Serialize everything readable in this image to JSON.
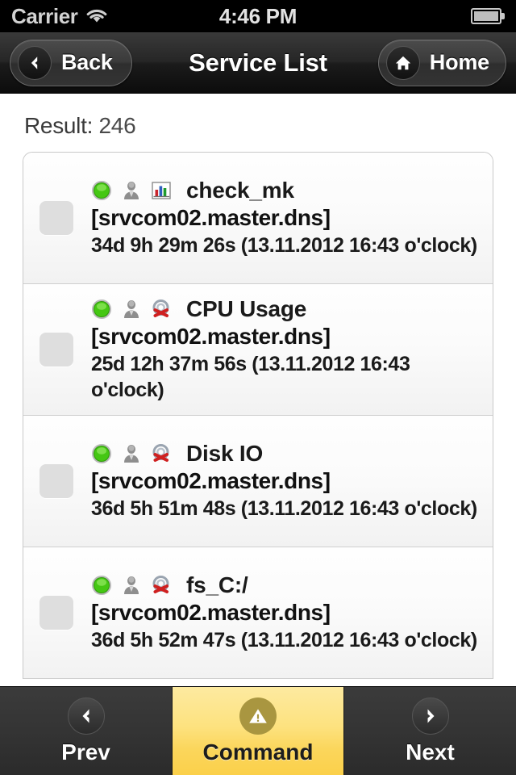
{
  "status_bar": {
    "carrier": "Carrier",
    "wifi_icon": "wifi-icon",
    "time": "4:46 PM",
    "battery_icon": "battery-icon"
  },
  "nav_bar": {
    "back_label": "Back",
    "back_icon": "chevron-left-icon",
    "title": "Service List",
    "home_label": "Home",
    "home_icon": "home-icon"
  },
  "content": {
    "result_label": "Result:",
    "result_count": "246"
  },
  "list": {
    "rows": [
      {
        "status_icon": "green-status-led-icon",
        "status_color": "#3fc014",
        "user_icon": "user-gray-icon",
        "graph_icon": "bar-chart-icon",
        "service": "check_mk",
        "host": "[srvcom02.master.dns]",
        "duration": "34d 9h 29m 26s (13.11.2012 16:43 o'clock)",
        "checkbox_checked": "false"
      },
      {
        "status_icon": "green-status-led-icon",
        "status_color": "#3fc014",
        "user_icon": "user-gray-icon",
        "graph_icon": "no-graph-icon",
        "service": "CPU Usage",
        "host": "[srvcom02.master.dns]",
        "duration": "25d 12h 37m 56s (13.11.2012 16:43 o'clock)",
        "checkbox_checked": "false"
      },
      {
        "status_icon": "green-status-led-icon",
        "status_color": "#3fc014",
        "user_icon": "user-gray-icon",
        "graph_icon": "no-graph-icon",
        "service": "Disk IO",
        "host": "[srvcom02.master.dns]",
        "duration": "36d 5h 51m 48s (13.11.2012 16:43 o'clock)",
        "checkbox_checked": "false"
      },
      {
        "status_icon": "green-status-led-icon",
        "status_color": "#3fc014",
        "user_icon": "user-gray-icon",
        "graph_icon": "no-graph-icon",
        "service": "fs_C:/",
        "host": "[srvcom02.master.dns]",
        "duration": "36d 5h 52m 47s (13.11.2012 16:43 o'clock)",
        "checkbox_checked": "false"
      }
    ]
  },
  "toolbar": {
    "prev_label": "Prev",
    "prev_icon": "chevron-left-icon",
    "command_label": "Command",
    "command_icon": "warning-triangle-icon",
    "next_label": "Next",
    "next_icon": "chevron-right-icon",
    "accent_color": "#fbd14b"
  }
}
